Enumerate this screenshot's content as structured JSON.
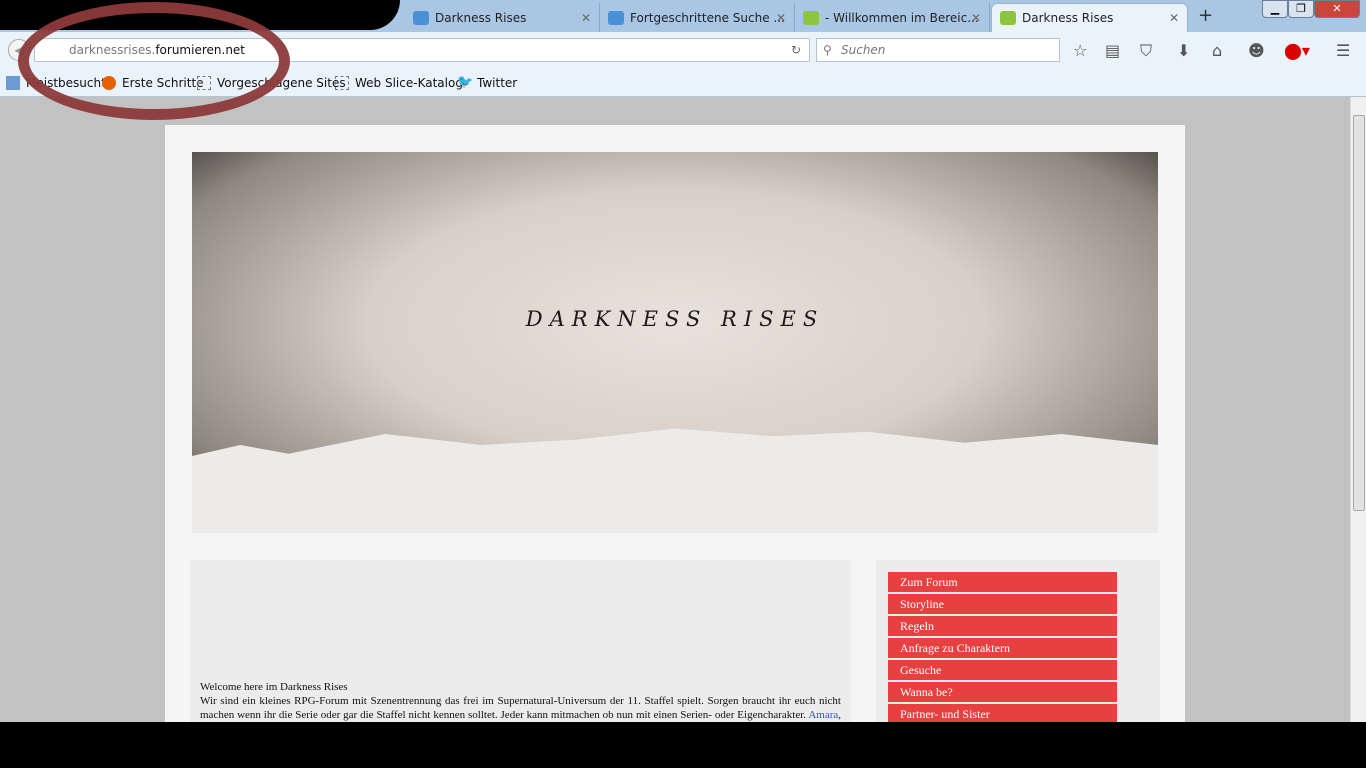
{
  "browser": {
    "tabs": [
      {
        "title": "Darkness Rises",
        "icon": "chat-bubble-blue-icon"
      },
      {
        "title": "Fortgeschrittene Suche ...",
        "icon": "chat-bubble-blue-icon"
      },
      {
        "title": "- Willkommen im Bereic...",
        "icon": "speech-bubble-green-icon"
      },
      {
        "title": "Darkness Rises",
        "icon": "speech-bubble-green-icon",
        "active": true
      }
    ],
    "url_host": "darknessrises.",
    "url_domain": "forumieren.net",
    "search_placeholder": "Suchen",
    "bookmarks": [
      "Meistbesucht",
      "Erste Schritte",
      "Vorgeschlagene Sites",
      "Web Slice-Katalog",
      "Twitter"
    ]
  },
  "banner": {
    "title": "DARKNESS RISES"
  },
  "content": {
    "heading": "Welcome here im Darkness Rises",
    "p1": "Wir sind ein kleines RPG-Forum mit Szenentrennung das frei im Supernatural-Universum der 11. Staffel spielt. Sorgen braucht ihr euch nicht machen wenn ihr die Serie oder gar die Staffel nicht kennen solltet. Jeder kann mitmachen ob nun mit einen Serien- oder Eigencharakter. ",
    "link": "Amara",
    "p2": ", die Dunkelheit, ist zurückgekehrt und auch Luzifer treibt frei sein Unwesen in unserer post-apokalyptischen Welt."
  },
  "menu": [
    "Zum Forum",
    "Storyline",
    "Regeln",
    "Anfrage zu Charaktern",
    "Gesuche",
    "Wanna be?",
    "Partner- und Sister"
  ],
  "colors": {
    "menu": "#e84040",
    "annotation_circle": "#8c3a3a"
  }
}
